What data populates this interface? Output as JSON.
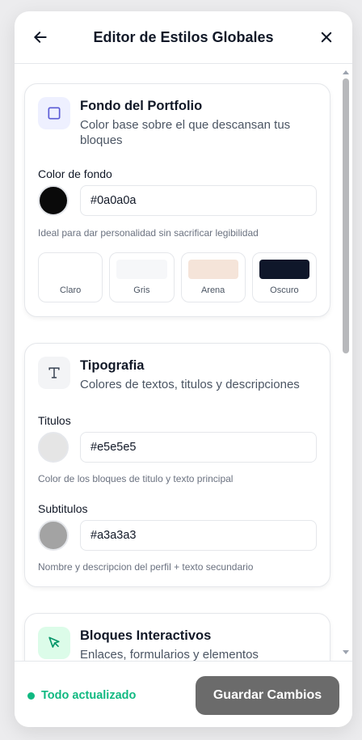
{
  "header": {
    "title": "Editor de Estilos Globales",
    "back_icon": "arrow-left-icon",
    "close_icon": "close-icon"
  },
  "background_card": {
    "icon": "square-icon",
    "icon_color": "#5b5bd6",
    "icon_bg": "#eef0ff",
    "title": "Fondo del Portfolio",
    "description": "Color base sobre el que descansan tus bloques",
    "field_label": "Color de fondo",
    "color_value": "#0a0a0a",
    "hint": "Ideal para dar personalidad sin sacrificar legibilidad",
    "presets": [
      {
        "label": "Claro",
        "color": "#ffffff"
      },
      {
        "label": "Gris",
        "color": "#f6f7f9"
      },
      {
        "label": "Arena",
        "color": "#f5e4d9"
      },
      {
        "label": "Oscuro",
        "color": "#0f172a"
      }
    ]
  },
  "typography_card": {
    "icon": "text-t-icon",
    "icon_color": "#374151",
    "icon_bg": "#f3f4f6",
    "title": "Tipografia",
    "description": "Colores de textos, titulos y descripciones",
    "titles_label": "Titulos",
    "titles_value": "#e5e5e5",
    "titles_hint": "Color de los bloques de titulo y texto principal",
    "subtitles_label": "Subtitulos",
    "subtitles_value": "#a3a3a3",
    "subtitles_hint": "Nombre y descripcion del perfil + texto secundario"
  },
  "interactive_card": {
    "icon": "cursor-arrow-icon",
    "icon_color": "#059669",
    "icon_bg": "#dcfce9",
    "title": "Bloques Interactivos",
    "description": "Enlaces, formularios y elementos"
  },
  "footer": {
    "status_text": "Todo actualizado",
    "status_color": "#10b981",
    "save_label": "Guardar Cambios",
    "save_color": "#6b6b6b"
  }
}
